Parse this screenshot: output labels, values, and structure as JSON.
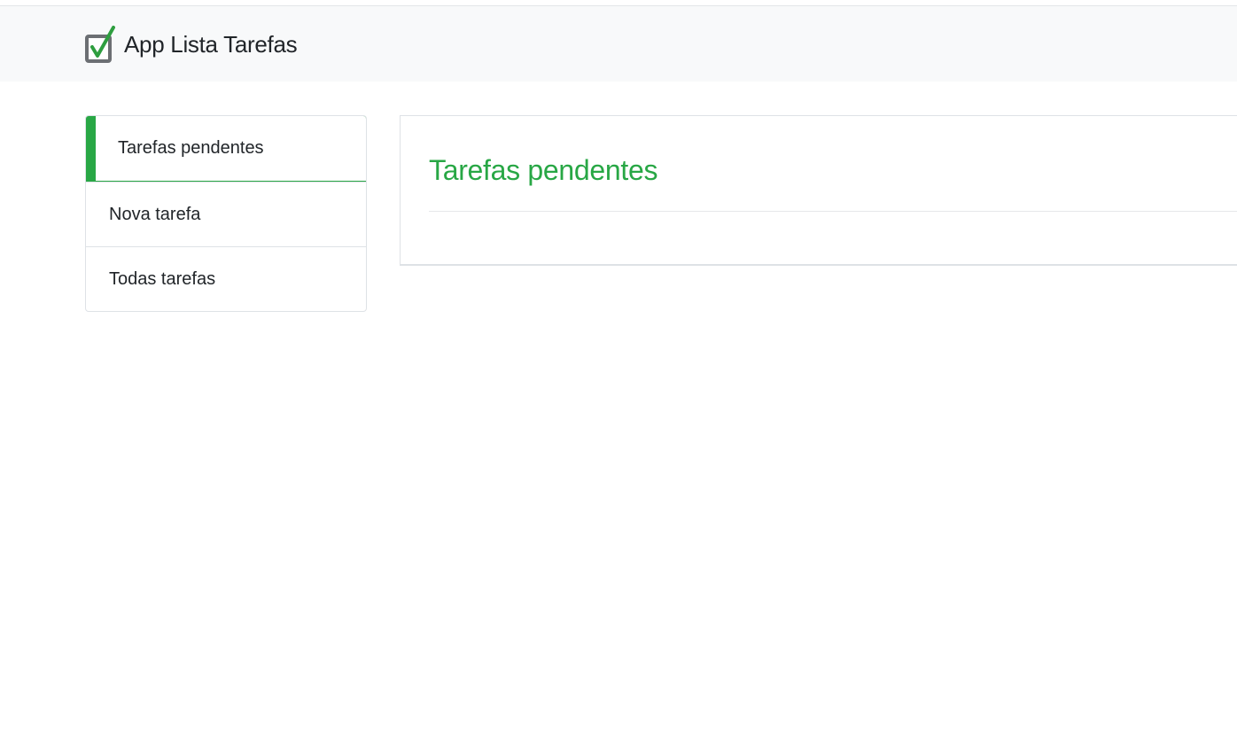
{
  "app": {
    "title": "App Lista Tarefas",
    "logo_icon": "checkbox-check-icon"
  },
  "colors": {
    "accent": "#28a745",
    "navbar_bg": "#f8f9fa",
    "text": "#212529",
    "border": "#dee2e6"
  },
  "sidebar": {
    "items": [
      {
        "label": "Tarefas pendentes",
        "active": true
      },
      {
        "label": "Nova tarefa",
        "active": false
      },
      {
        "label": "Todas tarefas",
        "active": false
      }
    ]
  },
  "main": {
    "title": "Tarefas pendentes"
  }
}
